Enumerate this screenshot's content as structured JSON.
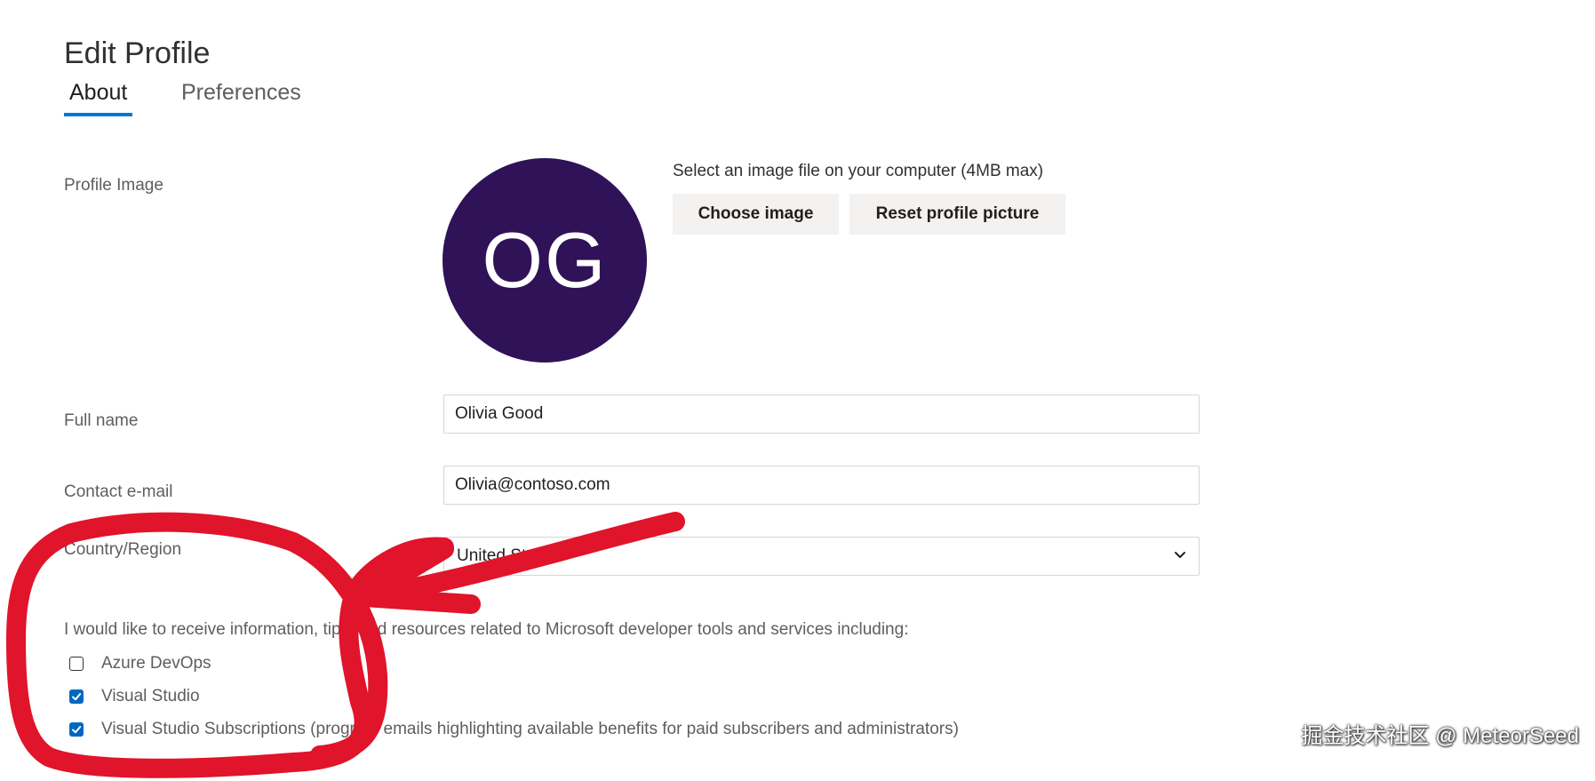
{
  "header": {
    "title": "Edit Profile"
  },
  "tabs": [
    {
      "label": "About",
      "active": true
    },
    {
      "label": "Preferences",
      "active": false
    }
  ],
  "profile_image": {
    "label": "Profile Image",
    "initials": "OG",
    "avatar_color": "#2f1257",
    "hint": "Select an image file on your computer (4MB max)",
    "choose_button": "Choose image",
    "reset_button": "Reset profile picture"
  },
  "full_name": {
    "label": "Full name",
    "value": "Olivia Good"
  },
  "contact_email": {
    "label": "Contact e-mail",
    "value": "Olivia@contoso.com"
  },
  "country": {
    "label": "Country/Region",
    "value": "United States",
    "icon": "chevron-down-icon"
  },
  "consent": {
    "text": "I would like to receive information, tips, and resources related to Microsoft developer tools and services including:",
    "options": [
      {
        "label": "Azure DevOps",
        "checked": false
      },
      {
        "label": "Visual Studio",
        "checked": true
      },
      {
        "label": "Visual Studio Subscriptions (program emails highlighting available benefits for paid subscribers and administrators)",
        "checked": true
      }
    ]
  },
  "watermark": "掘金技术社区 @ MeteorSeed",
  "colors": {
    "accent": "#0078d4",
    "checkbox": "#0067c0",
    "annotation": "#e0142a"
  }
}
